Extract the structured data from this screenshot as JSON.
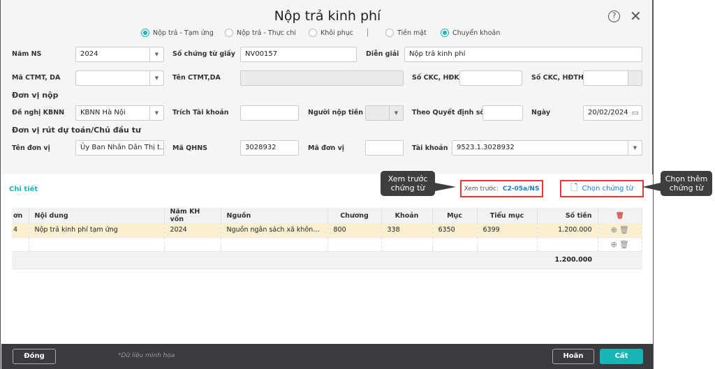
{
  "title": "Nộp trả kinh phí",
  "radios": [
    {
      "label": "Nộp trả - Tạm ứng",
      "checked": true
    },
    {
      "label": "Nộp trả - Thực chi",
      "checked": false
    },
    {
      "label": "Khôi phục",
      "checked": false
    },
    {
      "label": "Tiền mặt",
      "checked": false
    },
    {
      "label": "Chuyển khoản",
      "checked": true
    }
  ],
  "form": {
    "nam_ns_label": "Năm NS",
    "nam_ns": "2024",
    "so_ct_label": "Số chứng từ giấy",
    "so_ct": "NV00157",
    "dien_giai_label": "Diễn giải",
    "dien_giai": "Nộp trả kinh phí",
    "ma_ctmt_label": "Mã CTMT, DA",
    "ten_ctmt_label": "Tên CTMT,DA",
    "so_ckc_hdk_label": "Số CKC, HĐK",
    "so_ckc_hdth_label": "Số CKC, HĐTH",
    "don_vi_nop": "Đơn vị nộp",
    "de_nghi_label": "Đề nghị KBNN",
    "de_nghi": "KBNN Hà Nội",
    "trich_tk_label": "Trích Tài khoản",
    "nguoi_nop_label": "Người nộp tiền",
    "theo_qd_label": "Theo Quyết định số",
    "ngay_label": "Ngày",
    "ngay": "20/02/2024",
    "don_vi_rut": "Đơn vị rút dự toán/Chủ đầu tư",
    "ten_dv_label": "Tên đơn vị",
    "ten_dv": "Ủy Ban Nhân Dân Thị t...",
    "ma_qhns_label": "Mã QHNS",
    "ma_qhns": "3028932",
    "ma_dv_label": "Mã đơn vị",
    "tai_khoan_label": "Tài khoản",
    "tai_khoan": "9523.1.3028932"
  },
  "detail": {
    "tab": "Chi tiết",
    "preview_label": "Xem trước:",
    "preview_link": "C2-05a/NS",
    "choose_label": "Chọn chứng từ"
  },
  "callouts": {
    "preview": "Xem trước chứng từ",
    "choose": "Chọn thêm chứng từ"
  },
  "table": {
    "headers": [
      "ơn",
      "Nội dung",
      "Năm KH vốn",
      "Nguồn",
      "Chương",
      "Khoản",
      "Mục",
      "Tiểu mục",
      "Số tiền"
    ],
    "rows": [
      [
        "4",
        "Nộp trả kinh phí tạm ứng",
        "2024",
        "Nguồn ngân sách xã không ...",
        "800",
        "338",
        "6350",
        "6399",
        "1.200.000"
      ]
    ],
    "total": "1.200.000"
  },
  "footer": {
    "close": "Đóng",
    "note": "*Dữ liệu minh họa",
    "cancel": "Hoãn",
    "save": "Cất"
  },
  "colors": {
    "accent": "#19b4b4",
    "highlight": "#e53935"
  }
}
